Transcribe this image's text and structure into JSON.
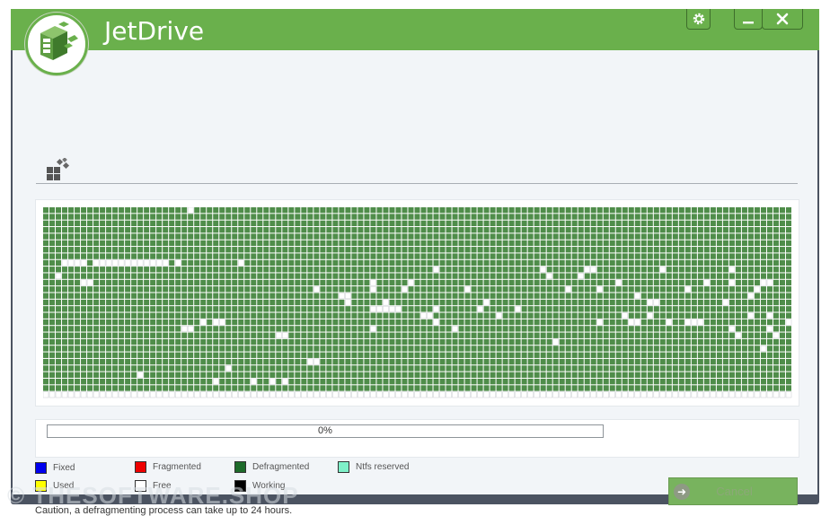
{
  "app": {
    "title": "JetDrive"
  },
  "titlebar": {
    "settings_icon": "gear-icon",
    "minimize_icon": "minimize-icon",
    "close_icon": "close-icon"
  },
  "toolbar": {
    "icon": "defrag-blocks-icon"
  },
  "cluster_map": {
    "rows": 29,
    "cols": 119,
    "colors": {
      "Defragmented": "#4f8d4a",
      "Free": "#ffffff"
    },
    "free_cells": [
      [
        0,
        23
      ],
      [
        8,
        3
      ],
      [
        8,
        4
      ],
      [
        8,
        5
      ],
      [
        8,
        6
      ],
      [
        8,
        8
      ],
      [
        8,
        9
      ],
      [
        8,
        10
      ],
      [
        8,
        11
      ],
      [
        8,
        12
      ],
      [
        8,
        13
      ],
      [
        8,
        14
      ],
      [
        8,
        15
      ],
      [
        8,
        16
      ],
      [
        8,
        17
      ],
      [
        8,
        18
      ],
      [
        8,
        19
      ],
      [
        8,
        21
      ],
      [
        8,
        31
      ],
      [
        9,
        62
      ],
      [
        9,
        79
      ],
      [
        9,
        86
      ],
      [
        9,
        87
      ],
      [
        9,
        98
      ],
      [
        9,
        109
      ],
      [
        10,
        2
      ],
      [
        10,
        80
      ],
      [
        10,
        85
      ],
      [
        11,
        6
      ],
      [
        11,
        7
      ],
      [
        11,
        52
      ],
      [
        11,
        58
      ],
      [
        11,
        91
      ],
      [
        11,
        105
      ],
      [
        11,
        109
      ],
      [
        11,
        114
      ],
      [
        11,
        115
      ],
      [
        12,
        43
      ],
      [
        12,
        52
      ],
      [
        12,
        57
      ],
      [
        12,
        67
      ],
      [
        12,
        83
      ],
      [
        12,
        88
      ],
      [
        12,
        102
      ],
      [
        12,
        113
      ],
      [
        12,
        113
      ],
      [
        12,
        119
      ],
      [
        13,
        47
      ],
      [
        13,
        48
      ],
      [
        13,
        94
      ],
      [
        13,
        112
      ],
      [
        14,
        48
      ],
      [
        14,
        54
      ],
      [
        14,
        70
      ],
      [
        14,
        96
      ],
      [
        14,
        97
      ],
      [
        14,
        108
      ],
      [
        14,
        119
      ],
      [
        15,
        52
      ],
      [
        15,
        53
      ],
      [
        15,
        54
      ],
      [
        15,
        55
      ],
      [
        15,
        56
      ],
      [
        15,
        62
      ],
      [
        15,
        69
      ],
      [
        15,
        75
      ],
      [
        16,
        60
      ],
      [
        16,
        61
      ],
      [
        16,
        72
      ],
      [
        16,
        92
      ],
      [
        16,
        96
      ],
      [
        16,
        112
      ],
      [
        16,
        115
      ],
      [
        17,
        25
      ],
      [
        17,
        27
      ],
      [
        17,
        28
      ],
      [
        17,
        62
      ],
      [
        17,
        88
      ],
      [
        17,
        93
      ],
      [
        17,
        94
      ],
      [
        17,
        99
      ],
      [
        17,
        102
      ],
      [
        17,
        103
      ],
      [
        17,
        104
      ],
      [
        17,
        118
      ],
      [
        18,
        22
      ],
      [
        18,
        23
      ],
      [
        18,
        52
      ],
      [
        18,
        65
      ],
      [
        18,
        109
      ],
      [
        18,
        115
      ],
      [
        19,
        37
      ],
      [
        19,
        38
      ],
      [
        19,
        110
      ],
      [
        19,
        116
      ],
      [
        20,
        81
      ],
      [
        21,
        114
      ],
      [
        23,
        42
      ],
      [
        23,
        43
      ],
      [
        24,
        29
      ],
      [
        25,
        15
      ],
      [
        26,
        27
      ],
      [
        26,
        33
      ],
      [
        26,
        36
      ],
      [
        26,
        38
      ]
    ],
    "free_rows_from": 28
  },
  "progress": {
    "value": 0,
    "label": "0%"
  },
  "legend": [
    {
      "label": "Fixed",
      "color": "#0000ee"
    },
    {
      "label": "Fragmented",
      "color": "#ee0000"
    },
    {
      "label": "Defragmented",
      "color": "#1e6b2a"
    },
    {
      "label": "Ntfs reserved",
      "color": "#7ff0c8"
    },
    {
      "label": "Used",
      "color": "#ffff00"
    },
    {
      "label": "Free",
      "color": "#ffffff"
    },
    {
      "label": "Working",
      "color": "#000000"
    }
  ],
  "caution": "Caution, a defragmenting process can take up to 24 hours.",
  "cancel_button": {
    "label": "Cancel",
    "icon": "arrow-right-icon"
  },
  "watermark": "© THESOFTWARE.SHOP",
  "colors": {
    "titlebar": "#6ab04c",
    "client": "#f2f5f8"
  }
}
